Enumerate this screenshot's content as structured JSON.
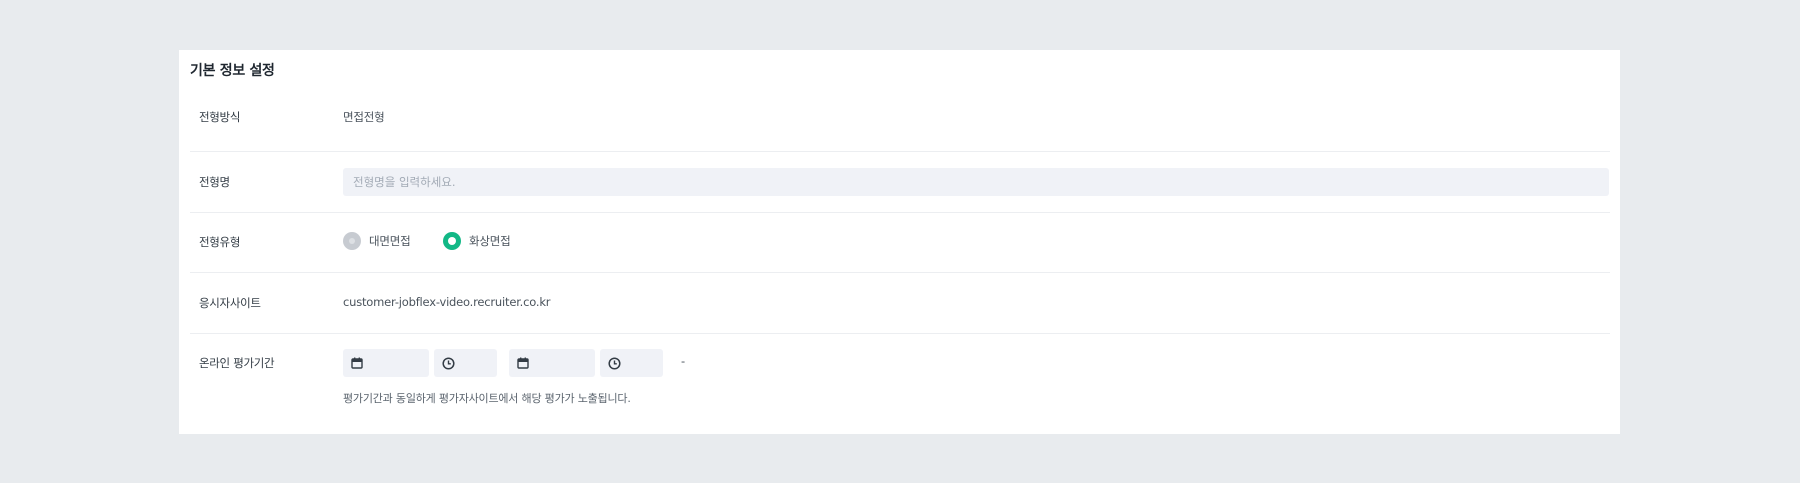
{
  "section": {
    "title": "기본 정보 설정"
  },
  "rows": {
    "method": {
      "label": "전형방식",
      "value": "면접전형"
    },
    "name": {
      "label": "전형명",
      "placeholder": "전형명을 입력하세요.",
      "value": ""
    },
    "type": {
      "label": "전형유형",
      "options": [
        {
          "label": "대면면접",
          "state": "disabled"
        },
        {
          "label": "화상면접",
          "state": "checked"
        }
      ]
    },
    "site": {
      "label": "응시자사이트",
      "value": "customer-jobflex-video.recruiter.co.kr"
    },
    "period": {
      "label": "온라인 평가기간",
      "separator": "-",
      "help": "평가기간과 동일하게 평가자사이트에서 해당 평가가 노출됩니다."
    }
  },
  "icons": {
    "date": "calendar-icon",
    "time": "clock-icon"
  },
  "colors": {
    "accent": "#12b886",
    "background": "#e8ebee",
    "input_bg": "#f0f2f7"
  }
}
